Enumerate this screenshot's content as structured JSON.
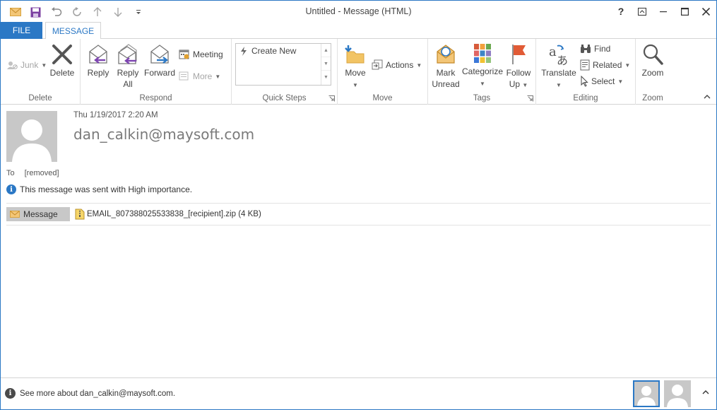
{
  "window": {
    "title": "Untitled - Message (HTML)",
    "help_label": "?",
    "accent_color": "#2b78c5"
  },
  "quick_access": {
    "icons": [
      "mail-icon",
      "save-icon",
      "undo-icon",
      "redo-icon",
      "previous-item-icon",
      "next-item-icon",
      "customize-qat-icon"
    ]
  },
  "tabs": {
    "file": "FILE",
    "message": "MESSAGE"
  },
  "ribbon": {
    "delete_group": {
      "label": "Delete",
      "junk": "Junk",
      "delete": "Delete"
    },
    "respond_group": {
      "label": "Respond",
      "reply": "Reply",
      "reply_all_line1": "Reply",
      "reply_all_line2": "All",
      "forward": "Forward",
      "meeting": "Meeting",
      "more": "More"
    },
    "quick_steps_group": {
      "label": "Quick Steps",
      "create_new": "Create New"
    },
    "move_group": {
      "label": "Move",
      "move": "Move",
      "actions": "Actions"
    },
    "tags_group": {
      "label": "Tags",
      "mark_unread_line1": "Mark",
      "mark_unread_line2": "Unread",
      "categorize": "Categorize",
      "follow_up_line1": "Follow",
      "follow_up_line2": "Up"
    },
    "editing_group": {
      "label": "Editing",
      "translate": "Translate",
      "find": "Find",
      "related": "Related",
      "select": "Select"
    },
    "zoom_group": {
      "label": "Zoom",
      "zoom": "Zoom"
    }
  },
  "message": {
    "date": "Thu 1/19/2017 2:20 AM",
    "sender": "dan_calkin@maysoft.com",
    "to_label": "To",
    "to_value": "[removed]",
    "importance_notice": "This message was sent with High importance.",
    "message_chip": "Message",
    "attachment": "EMAIL_807388025533838_[recipient].zip (4 KB)"
  },
  "people_pane": {
    "see_more": "See more about dan_calkin@maysoft.com."
  }
}
